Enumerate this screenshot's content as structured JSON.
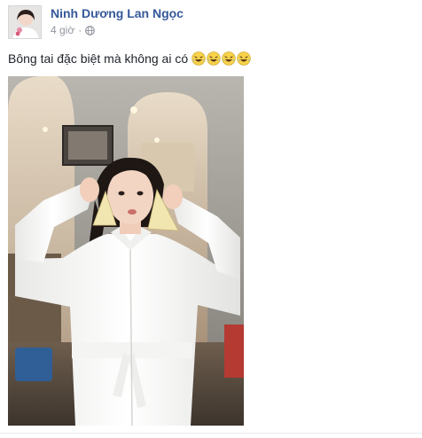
{
  "post": {
    "author": "Ninh Dương Lan Ngọc",
    "timestamp": "4 giờ",
    "separator": "·",
    "privacy_icon": "globe-icon",
    "caption": "Bông tai đặc biệt mà không ai có",
    "caption_emojis": [
      "laughing-tears-emoji",
      "laughing-tears-emoji",
      "laughing-tears-emoji",
      "laughing-tears-emoji"
    ],
    "author_color": "#365899",
    "meta_color": "#90949c"
  }
}
